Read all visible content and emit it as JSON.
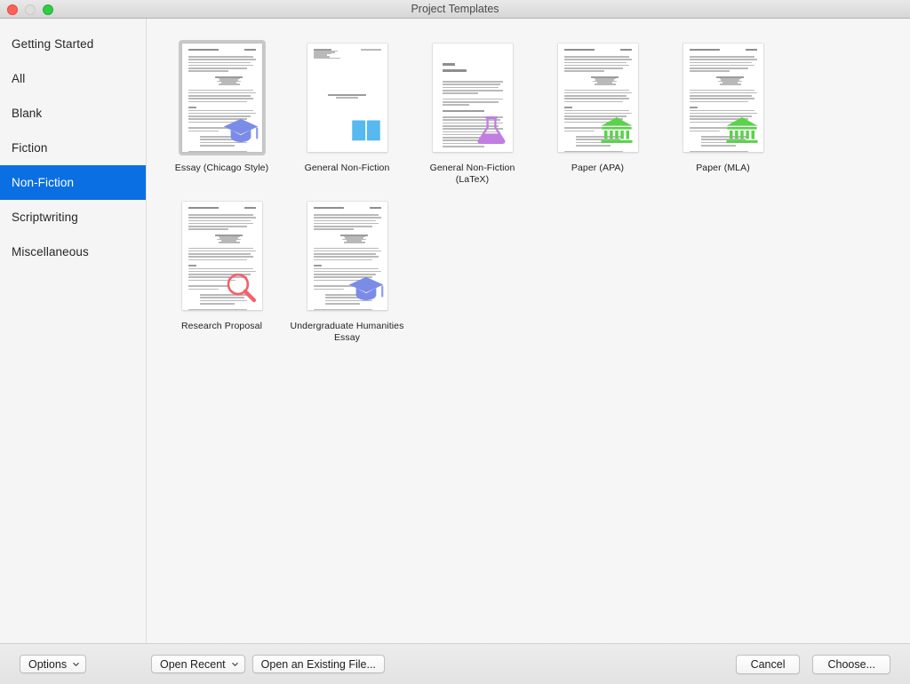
{
  "window": {
    "title": "Project Templates",
    "traffic_lights": [
      "close-button",
      "minimize-button",
      "zoom-button"
    ]
  },
  "sidebar": {
    "items": [
      {
        "label": "Getting Started",
        "selected": false
      },
      {
        "label": "All",
        "selected": false
      },
      {
        "label": "Blank",
        "selected": false
      },
      {
        "label": "Fiction",
        "selected": false
      },
      {
        "label": "Non-Fiction",
        "selected": true
      },
      {
        "label": "Scriptwriting",
        "selected": false
      },
      {
        "label": "Miscellaneous",
        "selected": false
      }
    ],
    "selection_color": "#0a6fe2"
  },
  "templates": [
    {
      "label": "Essay (Chicago Style)",
      "icon": "graduation-cap-icon",
      "icon_color": "#7b8ce8",
      "doc": "essay",
      "selected": true
    },
    {
      "label": "General Non-Fiction",
      "icon": "open-book-icon",
      "icon_color": "#56b9f0",
      "doc": "letter",
      "selected": false
    },
    {
      "label": "General Non-Fiction (LaTeX)",
      "icon": "flask-icon",
      "icon_color": "#c07ee0",
      "doc": "latex",
      "selected": false
    },
    {
      "label": "Paper (APA)",
      "icon": "bank-columns-icon",
      "icon_color": "#5ad24a",
      "doc": "essay",
      "selected": false
    },
    {
      "label": "Paper (MLA)",
      "icon": "bank-columns-icon",
      "icon_color": "#5ad24a",
      "doc": "essay",
      "selected": false
    },
    {
      "label": "Research Proposal",
      "icon": "magnifying-glass-icon",
      "icon_color": "#f4606a",
      "doc": "essay",
      "selected": false
    },
    {
      "label": "Undergraduate Humanities Essay",
      "icon": "graduation-cap-icon",
      "icon_color": "#7b8ce8",
      "doc": "essay",
      "selected": false
    }
  ],
  "bottom_bar": {
    "options_label": "Options",
    "open_recent_label": "Open Recent",
    "open_existing_label": "Open an Existing File...",
    "cancel_label": "Cancel",
    "choose_label": "Choose..."
  }
}
